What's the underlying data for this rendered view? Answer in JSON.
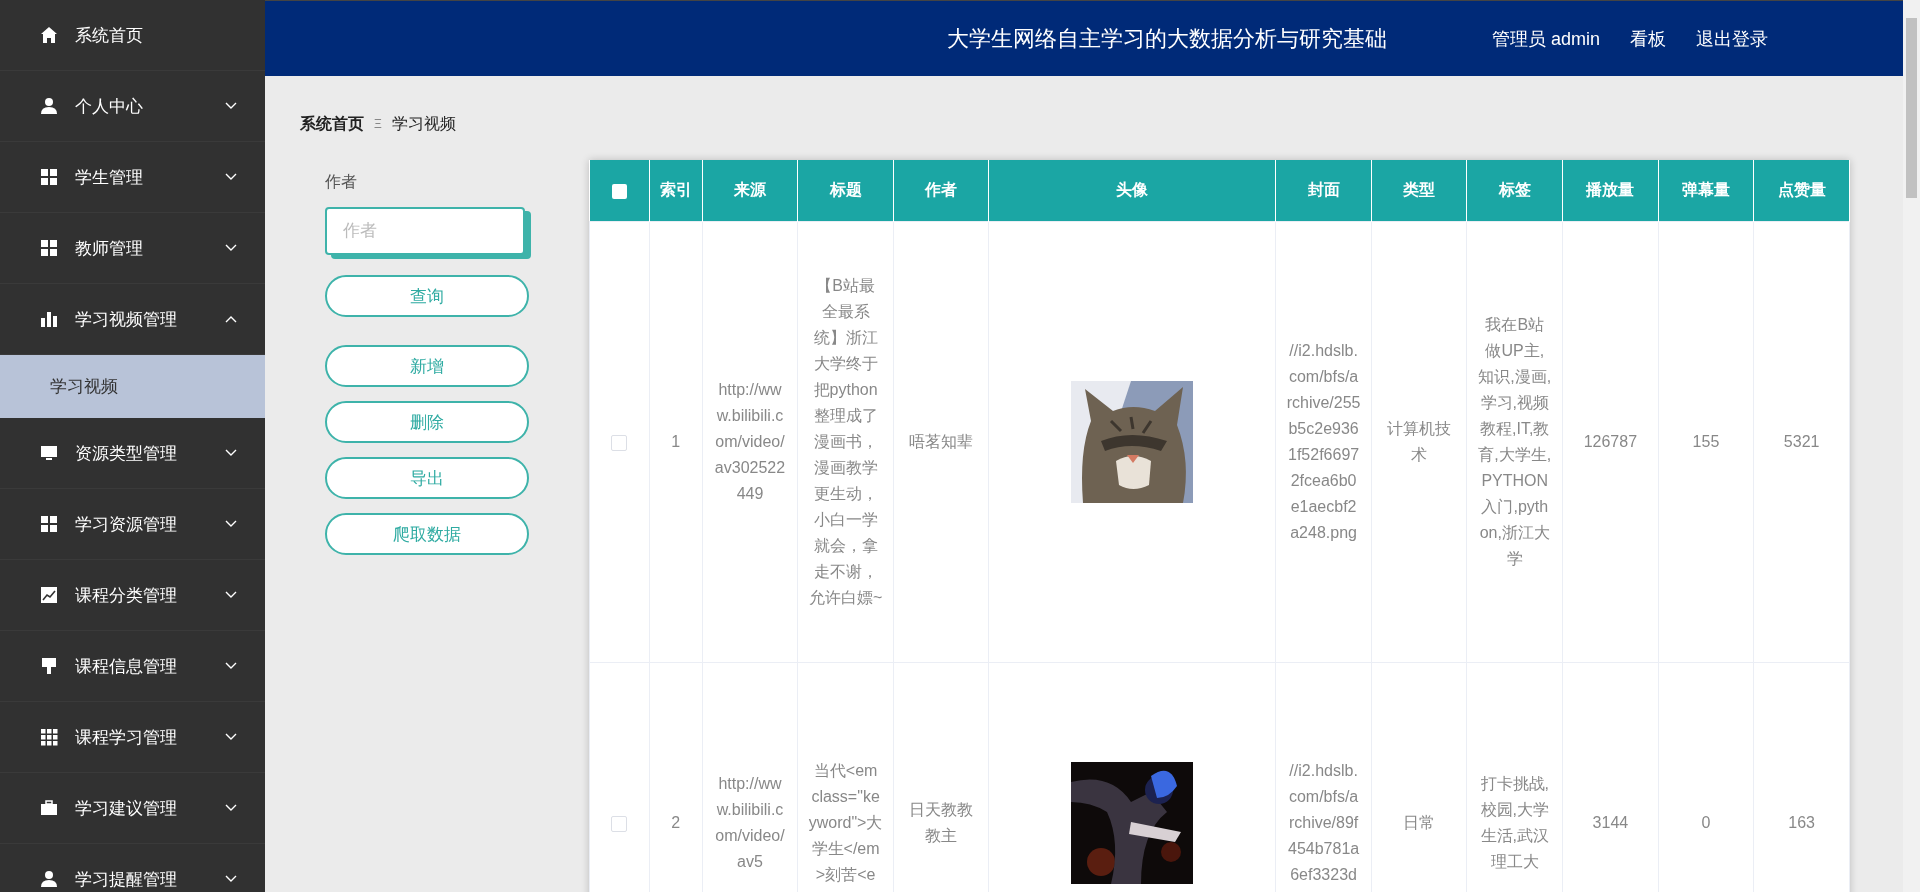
{
  "sidebar": {
    "items": [
      {
        "label": "系统首页",
        "kind": "link"
      },
      {
        "label": "个人中心",
        "kind": "group",
        "expanded": false
      },
      {
        "label": "学生管理",
        "kind": "group",
        "expanded": false
      },
      {
        "label": "教师管理",
        "kind": "group",
        "expanded": false
      },
      {
        "label": "学习视频管理",
        "kind": "group",
        "expanded": true,
        "children": [
          {
            "label": "学习视频",
            "selected": true
          }
        ]
      },
      {
        "label": "资源类型管理",
        "kind": "group",
        "expanded": false
      },
      {
        "label": "学习资源管理",
        "kind": "group",
        "expanded": false
      },
      {
        "label": "课程分类管理",
        "kind": "group",
        "expanded": false
      },
      {
        "label": "课程信息管理",
        "kind": "group",
        "expanded": false
      },
      {
        "label": "课程学习管理",
        "kind": "group",
        "expanded": false
      },
      {
        "label": "学习建议管理",
        "kind": "group",
        "expanded": false
      },
      {
        "label": "学习提醒管理",
        "kind": "group",
        "expanded": false
      }
    ]
  },
  "header": {
    "title": "大学生网络自主学习的大数据分析与研究基础",
    "user": "管理员 admin",
    "links": [
      "看板",
      "退出登录"
    ]
  },
  "breadcrumb": {
    "home": "系统首页",
    "separator": "Ξ",
    "current": "学习视频"
  },
  "search": {
    "label": "作者",
    "placeholder": "作者"
  },
  "buttons": [
    "查询",
    "新增",
    "删除",
    "导出",
    "爬取数据"
  ],
  "table": {
    "all_checked": false,
    "columns": [
      "索引",
      "来源",
      "标题",
      "作者",
      "头像",
      "封面",
      "类型",
      "标签",
      "播放量",
      "弹幕量",
      "点赞量"
    ],
    "rows": [
      {
        "checked": false,
        "cells": [
          "1",
          "http://www.bilibili.com/video/av302522449",
          "【B站最全最系统】浙江大学终于把python整理成了漫画书，漫画教学更生动，小白一学就会，拿走不谢，允许白嫖~",
          "唔茗知辈",
          {
            "kind": "picture"
          },
          "//i2.hdslb.com/bfs/archive/255b5c2e9361f52f66972fcea6b0e1aecbf2a248.png",
          "计算机技术",
          "我在B站做UP主,知识,漫画,学习,视频教程,IT,教育,大学生,PYTHON入门,python,浙江大学",
          "126787",
          "155",
          "5321"
        ]
      },
      {
        "checked": false,
        "cells": [
          "2",
          "http://www.bilibili.com/video/av5",
          "当代<em class=\"keyword\">大学生</em>刻苦<e",
          "日天教教教主",
          {
            "kind": "picture"
          },
          "//i2.hdslb.com/bfs/archive/89f454b781a6ef3323d",
          "日常",
          "打卡挑战,校园,大学生活,武汉理工大",
          "3144",
          "0",
          "163"
        ]
      }
    ]
  }
}
